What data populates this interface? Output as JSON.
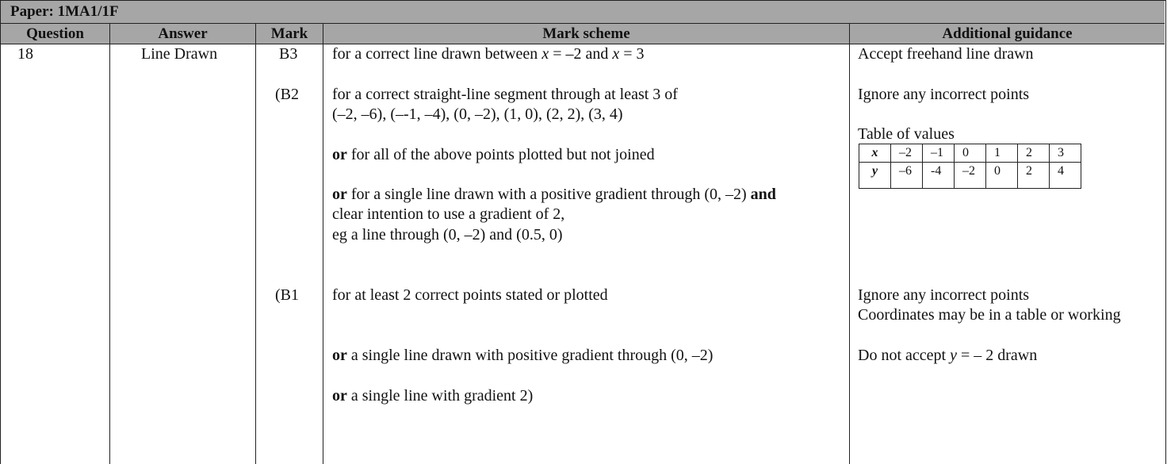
{
  "paper": "Paper: 1MA1/1F",
  "headers": {
    "question": "Question",
    "answer": "Answer",
    "mark": "Mark",
    "mark_scheme": "Mark scheme",
    "guidance": "Additional guidance"
  },
  "row": {
    "question": "18",
    "answer": "Line Drawn",
    "marks": [
      "B3",
      "(B2",
      "(B1"
    ],
    "scheme": {
      "b3": {
        "pre": "for a correct line drawn between ",
        "x1": "x",
        "mid": " = –2 and ",
        "x2": "x",
        "post": " = 3"
      },
      "b2_line1": "for a correct straight-line segment through at least 3 of",
      "b2_line2": "(–2, –6), (–-1, –4), (0, –2), (1, 0), (2, 2), (3, 4)",
      "b2_or1_kw": "or",
      "b2_or1_rest": " for all of the above points plotted but not joined",
      "b2_or2_kw": "or",
      "b2_or2_rest": " for a single line drawn with a positive gradient through (0, –2) ",
      "b2_or2_and": "and",
      "b2_or2_line2": "clear intention to use a gradient of 2,",
      "b2_or2_line3": "eg a line through (0, –2) and (0.5, 0)",
      "b1_line1": "for at least 2 correct points stated or plotted",
      "b1_or1_kw": "or",
      "b1_or1_rest": " a single line drawn with positive gradient through (0, –2)",
      "b1_or2_kw": "or",
      "b1_or2_rest": " a single line with gradient 2)"
    },
    "guidance": {
      "g1": "Accept freehand line drawn",
      "g2": "Ignore any incorrect points",
      "g3": "Table of values",
      "table": {
        "x_label": "x",
        "y_label": "y",
        "x_values": [
          "–2",
          "–1",
          "0",
          "1",
          "2",
          "3"
        ],
        "y_values": [
          "–6",
          "-4",
          "–2",
          "0",
          "2",
          "4"
        ]
      },
      "g4": "Ignore any incorrect points",
      "g5": "Coordinates may be in a table or working",
      "g6_pre": "Do not accept ",
      "g6_var": "y",
      "g6_post": " = – 2 drawn"
    }
  }
}
